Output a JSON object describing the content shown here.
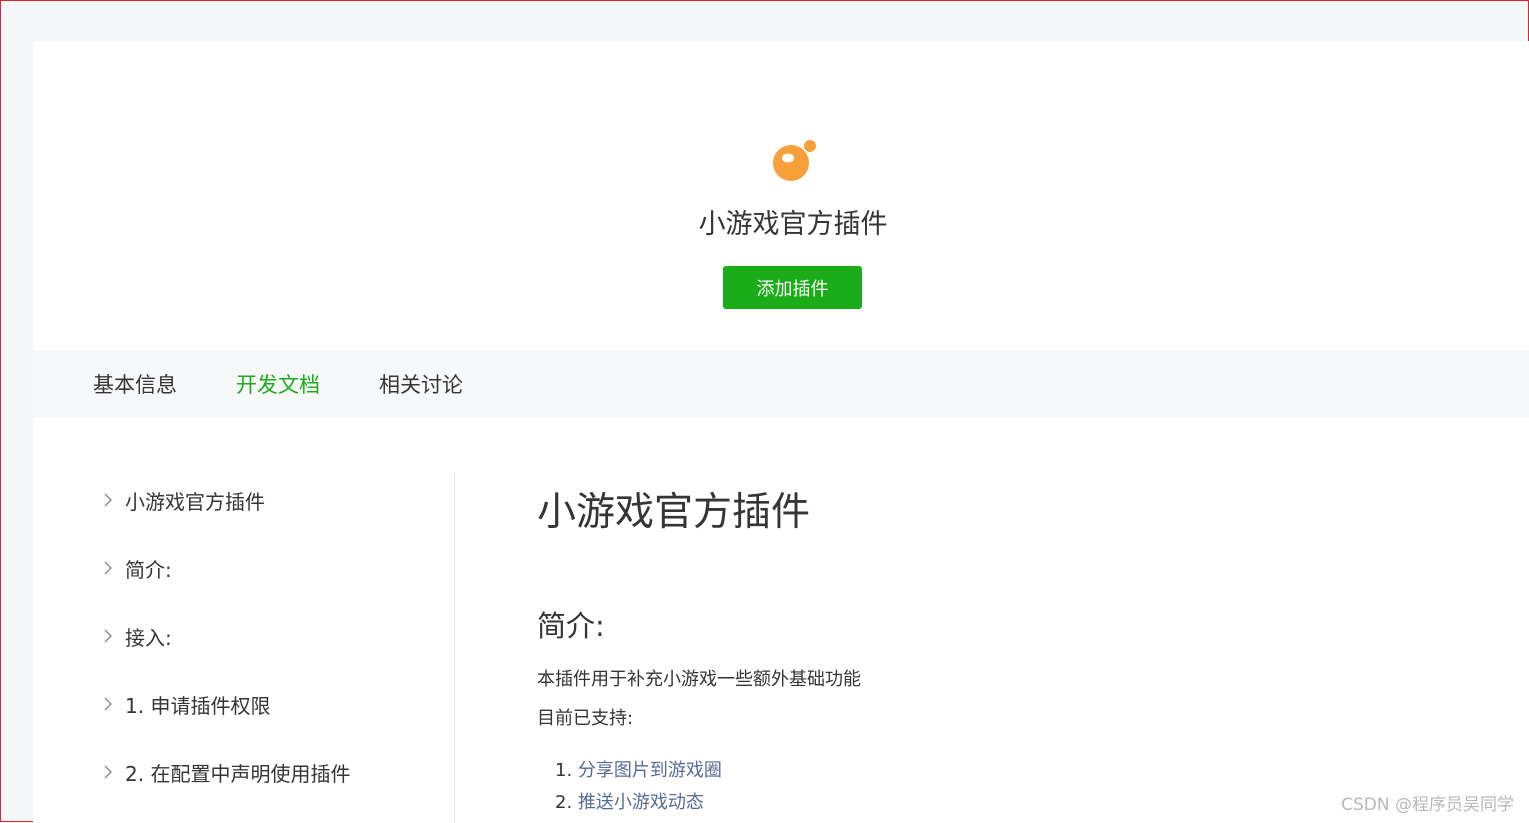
{
  "plugin": {
    "name": "小游戏官方插件",
    "add_button": "添加插件",
    "logo_color": "#f7a03a"
  },
  "tabs": [
    {
      "label": "基本信息",
      "active": false
    },
    {
      "label": "开发文档",
      "active": true
    },
    {
      "label": "相关讨论",
      "active": false
    }
  ],
  "toc": [
    {
      "label": "小游戏官方插件"
    },
    {
      "label": "简介:"
    },
    {
      "label": "接入:"
    },
    {
      "label": "1. 申请插件权限"
    },
    {
      "label": "2. 在配置中声明使用插件"
    }
  ],
  "doc": {
    "title": "小游戏官方插件",
    "section_title": "简介:",
    "intro": "本插件用于补充小游戏一些额外基础功能",
    "supported_label": "目前已支持:",
    "features": [
      {
        "num": "1.",
        "link": "分享图片到游戏圈"
      },
      {
        "num": "2.",
        "link": "推送小游戏动态"
      }
    ]
  },
  "colors": {
    "accent_green": "#1aad19",
    "link_blue": "#576b95"
  },
  "watermark": "CSDN @程序员吴同学"
}
